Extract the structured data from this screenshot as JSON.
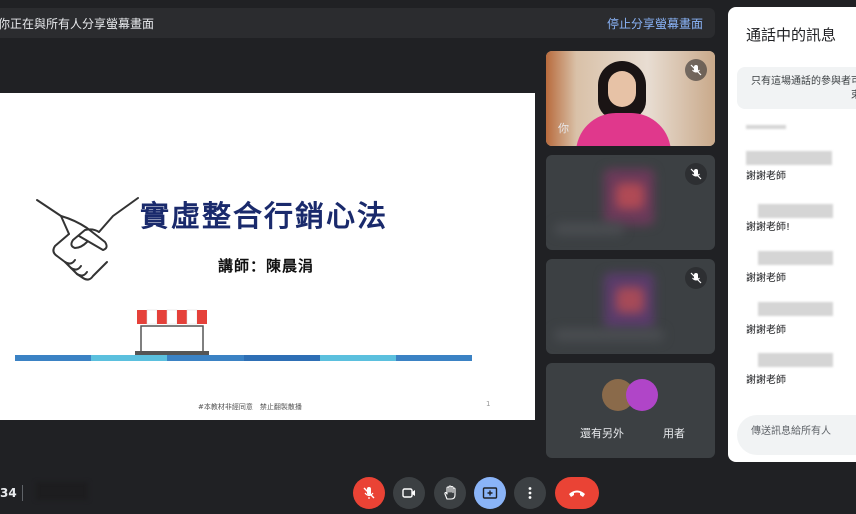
{
  "banner": {
    "message": "你正在與所有人分享螢幕畫面",
    "stop_label": "停止分享螢幕畫面"
  },
  "slide": {
    "title": "實虛整合行銷心法",
    "lecturer": "講師：陳晨涓",
    "footer": "#本教材非經同意　禁止翻製散播",
    "page_number": "1",
    "stripe_colors": [
      "#3b82c4",
      "#5bc0de",
      "#3b82c4",
      "#2e6fb5",
      "#5bc0de",
      "#3b82c4"
    ]
  },
  "tiles": [
    {
      "name": "你",
      "muted": true
    },
    {
      "name": "",
      "muted": true
    },
    {
      "name": "",
      "muted": true
    },
    {
      "name": "還有另外",
      "name_suffix": "用者",
      "muted": false
    }
  ],
  "chat": {
    "title": "通話中的訊息",
    "notice_line1": "只有這場通話的參與者可",
    "notice_line2": "束",
    "messages": [
      "謝謝老師",
      "謝謝老師!",
      "謝謝老師",
      "謝謝老師",
      "謝謝老師"
    ],
    "input_placeholder": "傳送訊息給所有人"
  },
  "bottom": {
    "clock": "34"
  },
  "colors": {
    "background": "#202124",
    "end_call": "#ea4335",
    "mic_off": "#ea4335",
    "present_active": "#8ab4f8",
    "control": "#3c4043",
    "link": "#8ab4f8"
  }
}
